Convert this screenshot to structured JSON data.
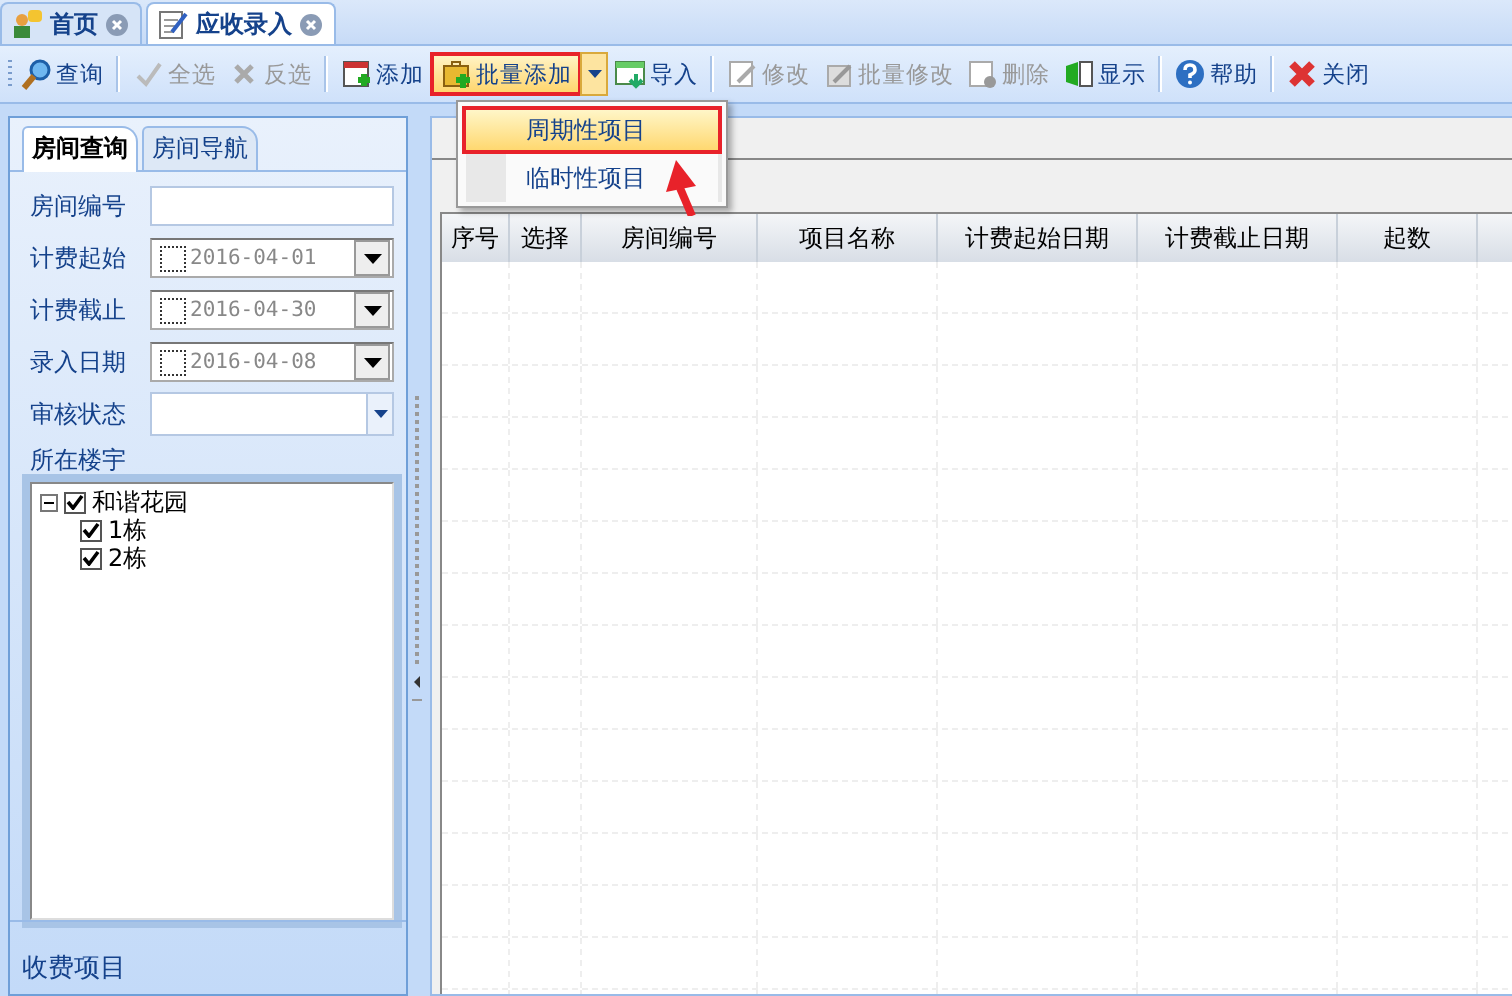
{
  "doc_tabs": [
    {
      "label": "首页",
      "selected": false
    },
    {
      "label": "应收录入",
      "selected": true
    }
  ],
  "toolbar": [
    {
      "label": "查询",
      "disabled": false,
      "highlighted": false
    },
    {
      "label": "全选",
      "disabled": true,
      "highlighted": false
    },
    {
      "label": "反选",
      "disabled": true,
      "highlighted": false
    },
    {
      "label": "添加",
      "disabled": false,
      "highlighted": false
    },
    {
      "label": "批量添加",
      "disabled": false,
      "highlighted": true
    },
    {
      "label": "导入",
      "disabled": false,
      "highlighted": false
    },
    {
      "label": "修改",
      "disabled": true,
      "highlighted": false
    },
    {
      "label": "批量修改",
      "disabled": true,
      "highlighted": false
    },
    {
      "label": "删除",
      "disabled": true,
      "highlighted": false
    },
    {
      "label": "显示",
      "disabled": false,
      "highlighted": false
    },
    {
      "label": "帮助",
      "disabled": false,
      "highlighted": false
    },
    {
      "label": "关闭",
      "disabled": false,
      "highlighted": false
    }
  ],
  "dropdown_menu": [
    {
      "label": "周期性项目",
      "selected": true
    },
    {
      "label": "临时性项目",
      "selected": false
    }
  ],
  "panel_tabs": [
    {
      "label": "房间查询",
      "selected": true
    },
    {
      "label": "房间导航",
      "selected": false
    }
  ],
  "form": [
    {
      "kind": "text",
      "label": "房间编号"
    },
    {
      "kind": "date",
      "label": "计费起始",
      "value": "2016-04-01",
      "checked": false
    },
    {
      "kind": "date",
      "label": "计费截止",
      "value": "2016-04-30",
      "checked": false
    },
    {
      "kind": "date",
      "label": "录入日期",
      "value": "2016-04-08",
      "checked": false
    },
    {
      "kind": "combo",
      "label": "审核状态"
    }
  ],
  "building_label": "所在楼宇",
  "tree": [
    {
      "label": "和谐花园",
      "checked": true,
      "expanded": true,
      "children": [
        {
          "label": "1栋",
          "checked": true
        },
        {
          "label": "2栋",
          "checked": true
        }
      ]
    }
  ],
  "footer_section": "收费项目",
  "table": {
    "columns": [
      "序号",
      "选择",
      "房间编号",
      "项目名称",
      "计费起始日期",
      "计费截止日期",
      "起数"
    ]
  }
}
